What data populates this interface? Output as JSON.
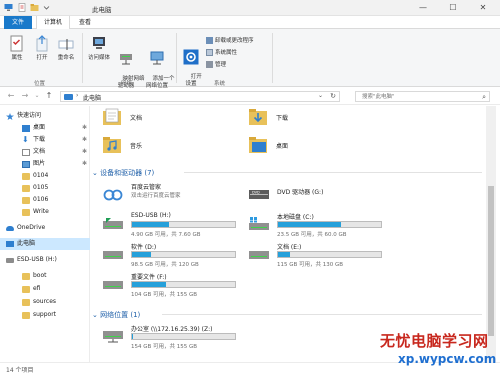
{
  "window": {
    "title": "此电脑",
    "controls": {
      "minimize": "—",
      "maximize": "☐",
      "close": "✕"
    }
  },
  "ribbon": {
    "tabs": [
      {
        "label": "文件"
      },
      {
        "label": "计算机"
      },
      {
        "label": "查看"
      }
    ],
    "groups": {
      "location": {
        "label": "位置",
        "buttons": [
          {
            "label": "属性",
            "icon": "properties-icon"
          },
          {
            "label": "打开",
            "icon": "open-icon"
          },
          {
            "label": "重命名",
            "icon": "rename-icon"
          }
        ]
      },
      "network": {
        "label": "网络",
        "buttons": [
          {
            "label": "访问媒体",
            "icon": "media-icon"
          },
          {
            "label": "映射网络\n驱动器",
            "icon": "map-drive-icon"
          },
          {
            "label": "添加一个\n网络位置",
            "icon": "add-network-location-icon"
          }
        ]
      },
      "system": {
        "label": "系统",
        "buttons": [
          {
            "label": "打开\n设置",
            "icon": "settings-icon"
          }
        ],
        "small_buttons": [
          {
            "label": "卸载或更改程序"
          },
          {
            "label": "系统属性"
          },
          {
            "label": "管理"
          }
        ]
      }
    }
  },
  "address": {
    "path": "此电脑",
    "separator": "›",
    "search_placeholder": "搜索\"此电脑\""
  },
  "nav_pane": {
    "items": [
      {
        "label": "快速访问",
        "icon": "star-icon",
        "level": 0
      },
      {
        "label": "桌面",
        "icon": "desktop-icon",
        "level": 1,
        "pinned": true
      },
      {
        "label": "下载",
        "icon": "download-icon",
        "level": 1,
        "pinned": true
      },
      {
        "label": "文档",
        "icon": "document-icon",
        "level": 1,
        "pinned": true
      },
      {
        "label": "图片",
        "icon": "pictures-icon",
        "level": 1,
        "pinned": true
      },
      {
        "label": "0104",
        "icon": "folder-icon",
        "level": 1
      },
      {
        "label": "0105",
        "icon": "folder-icon",
        "level": 1
      },
      {
        "label": "0106",
        "icon": "folder-icon",
        "level": 1
      },
      {
        "label": "Write",
        "icon": "folder-icon",
        "level": 1
      },
      {
        "label": "OneDrive",
        "icon": "onedrive-icon",
        "level": 0
      },
      {
        "label": "此电脑",
        "icon": "this-pc-icon",
        "level": 0,
        "selected": true
      },
      {
        "label": "ESD-USB (H:)",
        "icon": "usb-drive-icon",
        "level": 0
      },
      {
        "label": "boot",
        "icon": "folder-icon",
        "level": 1
      },
      {
        "label": "efi",
        "icon": "folder-icon",
        "level": 1
      },
      {
        "label": "sources",
        "icon": "folder-icon",
        "level": 1
      },
      {
        "label": "support",
        "icon": "folder-icon",
        "level": 1
      }
    ]
  },
  "folders": [
    {
      "name": "文档",
      "icon": "document-folder-icon"
    },
    {
      "name": "下载",
      "icon": "download-folder-icon"
    },
    {
      "name": "音乐",
      "icon": "music-folder-icon"
    },
    {
      "name": "桌面",
      "icon": "desktop-folder-icon"
    }
  ],
  "devices_section": {
    "title": "设备和驱动器 (7)"
  },
  "drives": [
    {
      "name": "百度云管家",
      "free": "双击运行百度云管家",
      "icon": "baidu-cloud-icon",
      "used": null
    },
    {
      "name": "DVD 驱动器 (G:)",
      "free": "",
      "icon": "dvd-drive-icon",
      "used": null
    },
    {
      "name": "ESD-USB (H:)",
      "free": "4.90 GB 可用，共 7.60 GB",
      "icon": "usb-drive-icon",
      "used": 0.36
    },
    {
      "name": "本地磁盘 (C:)",
      "free": "23.5 GB 可用，共 60.0 GB",
      "icon": "windows-drive-icon",
      "used": 0.61
    },
    {
      "name": "软件 (D:)",
      "free": "98.5 GB 可用，共 120 GB",
      "icon": "hard-drive-icon",
      "used": 0.18
    },
    {
      "name": "文档 (E:)",
      "free": "115 GB 可用，共 130 GB",
      "icon": "hard-drive-icon",
      "used": 0.12
    },
    {
      "name": "重要文件 (F:)",
      "free": "104 GB 可用，共 155 GB",
      "icon": "hard-drive-icon",
      "used": 0.33
    }
  ],
  "network_section": {
    "title": "网络位置 (1)"
  },
  "network_drives": [
    {
      "name": "办公室 (\\\\172.16.25.39) (Z:)",
      "free": "154 GB 可用，共 155 GB",
      "icon": "network-drive-icon",
      "used": 0.01
    }
  ],
  "status_bar": {
    "text": "14 个项目"
  },
  "watermark": {
    "line1": "无忧电脑学习网",
    "line2": "xp.wypcw.com"
  },
  "colors": {
    "accent": "#1979ca",
    "bar_fill": "#26a0da",
    "folder": "#e8c15a",
    "section_title": "#1e5fa8",
    "selected_bg": "#cce8ff"
  }
}
